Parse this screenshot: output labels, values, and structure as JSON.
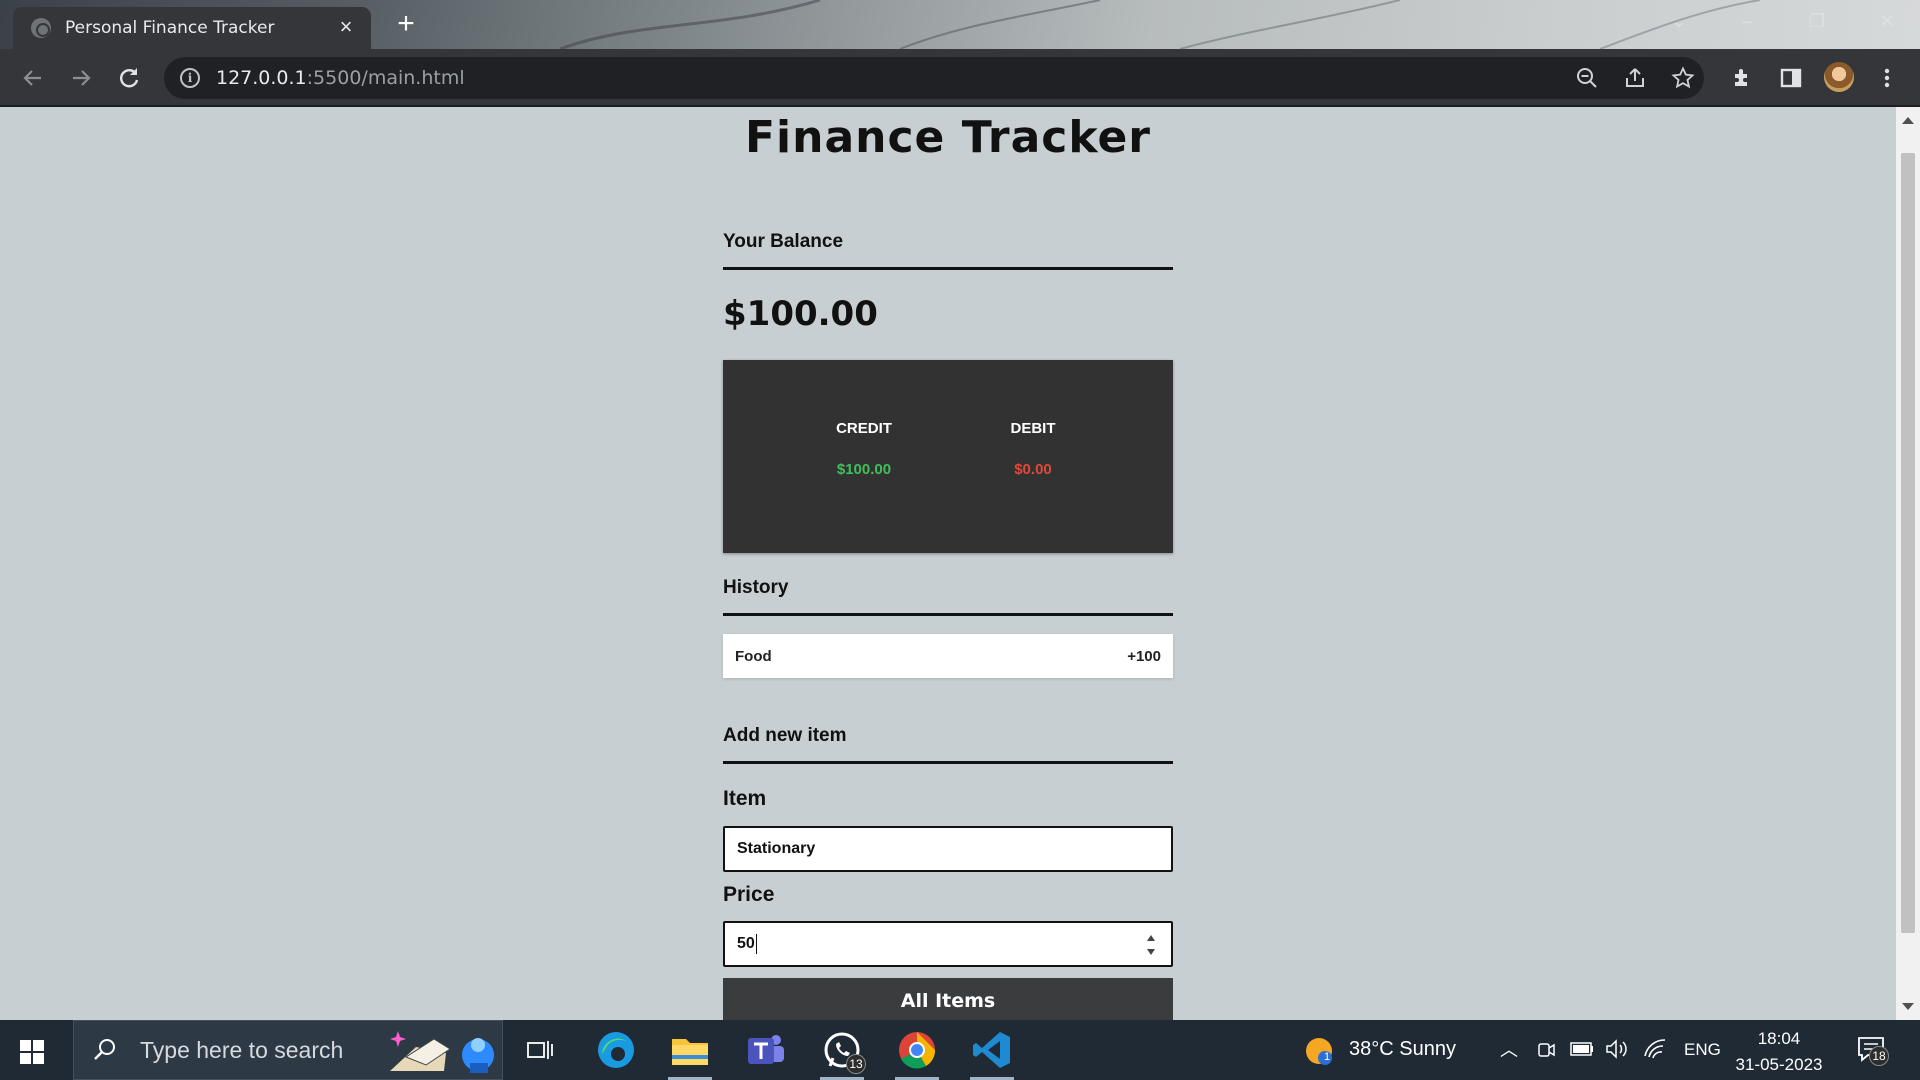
{
  "browser": {
    "tab_title": "Personal Finance Tracker",
    "url_host": "127.0.0.1",
    "url_rest": ":5500/main.html",
    "icons": [
      "back-arrow-icon",
      "forward-arrow-icon",
      "reload-icon",
      "info-icon",
      "zoom-icon",
      "share-icon",
      "star-icon",
      "extensions-icon",
      "side-panel-icon",
      "avatar",
      "more-menu-icon"
    ]
  },
  "page": {
    "title": "Finance Tracker",
    "balance_heading": "Your Balance",
    "balance": "$100.00",
    "summary": {
      "credit_label": "CREDIT",
      "credit_value": "$100.00",
      "debit_label": "DEBIT",
      "debit_value": "$0.00",
      "credit_color": "#3fc05a",
      "debit_color": "#e0483a"
    },
    "history_heading": "History",
    "history": [
      {
        "name": "Food",
        "amount": "+100"
      }
    ],
    "add_heading": "Add new item",
    "item_label": "Item",
    "item_value": "Stationary",
    "price_label": "Price",
    "price_value": "50",
    "submit_label": "All Items"
  },
  "taskbar": {
    "search_placeholder": "Type here to search",
    "whatsapp_badge": "13",
    "weather": "38°C  Sunny",
    "weather_badge": "1",
    "language": "ENG",
    "time": "18:04",
    "date": "31-05-2023",
    "notifications_count": "18"
  }
}
